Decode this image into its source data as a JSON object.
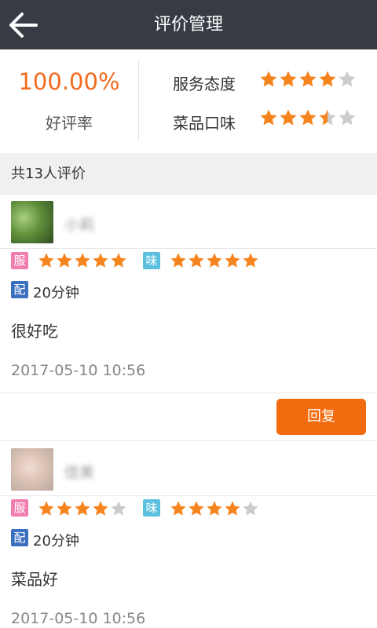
{
  "header": {
    "title": "评价管理",
    "back_icon": "arrow-left-icon"
  },
  "summary": {
    "good_rate_value": "100.00%",
    "good_rate_label": "好评率",
    "service_label": "服务态度",
    "service_rating": 4,
    "taste_label": "菜品口味",
    "taste_rating": 3.5
  },
  "reviews_header": {
    "count_text": "共13人评价"
  },
  "reviews": [
    {
      "service_badge": "服",
      "service_rating": 5,
      "taste_badge": "味",
      "taste_rating": 5,
      "delivery_badge": "配",
      "delivery_time": "20分钟",
      "comment": "很好吃",
      "timestamp": "2017-05-10 10:56",
      "reply_label": "回复"
    },
    {
      "service_badge": "服",
      "service_rating": 4,
      "taste_badge": "味",
      "taste_rating": 4,
      "delivery_badge": "配",
      "delivery_time": "20分钟",
      "comment": "菜品好",
      "timestamp": "2017-05-10 10:56"
    }
  ],
  "colors": {
    "header_bg": "#373b44",
    "accent_orange": "#f36b1c",
    "star_filled": "#f5841f",
    "star_empty": "#cccccc",
    "reply_button": "#f26b0f"
  }
}
